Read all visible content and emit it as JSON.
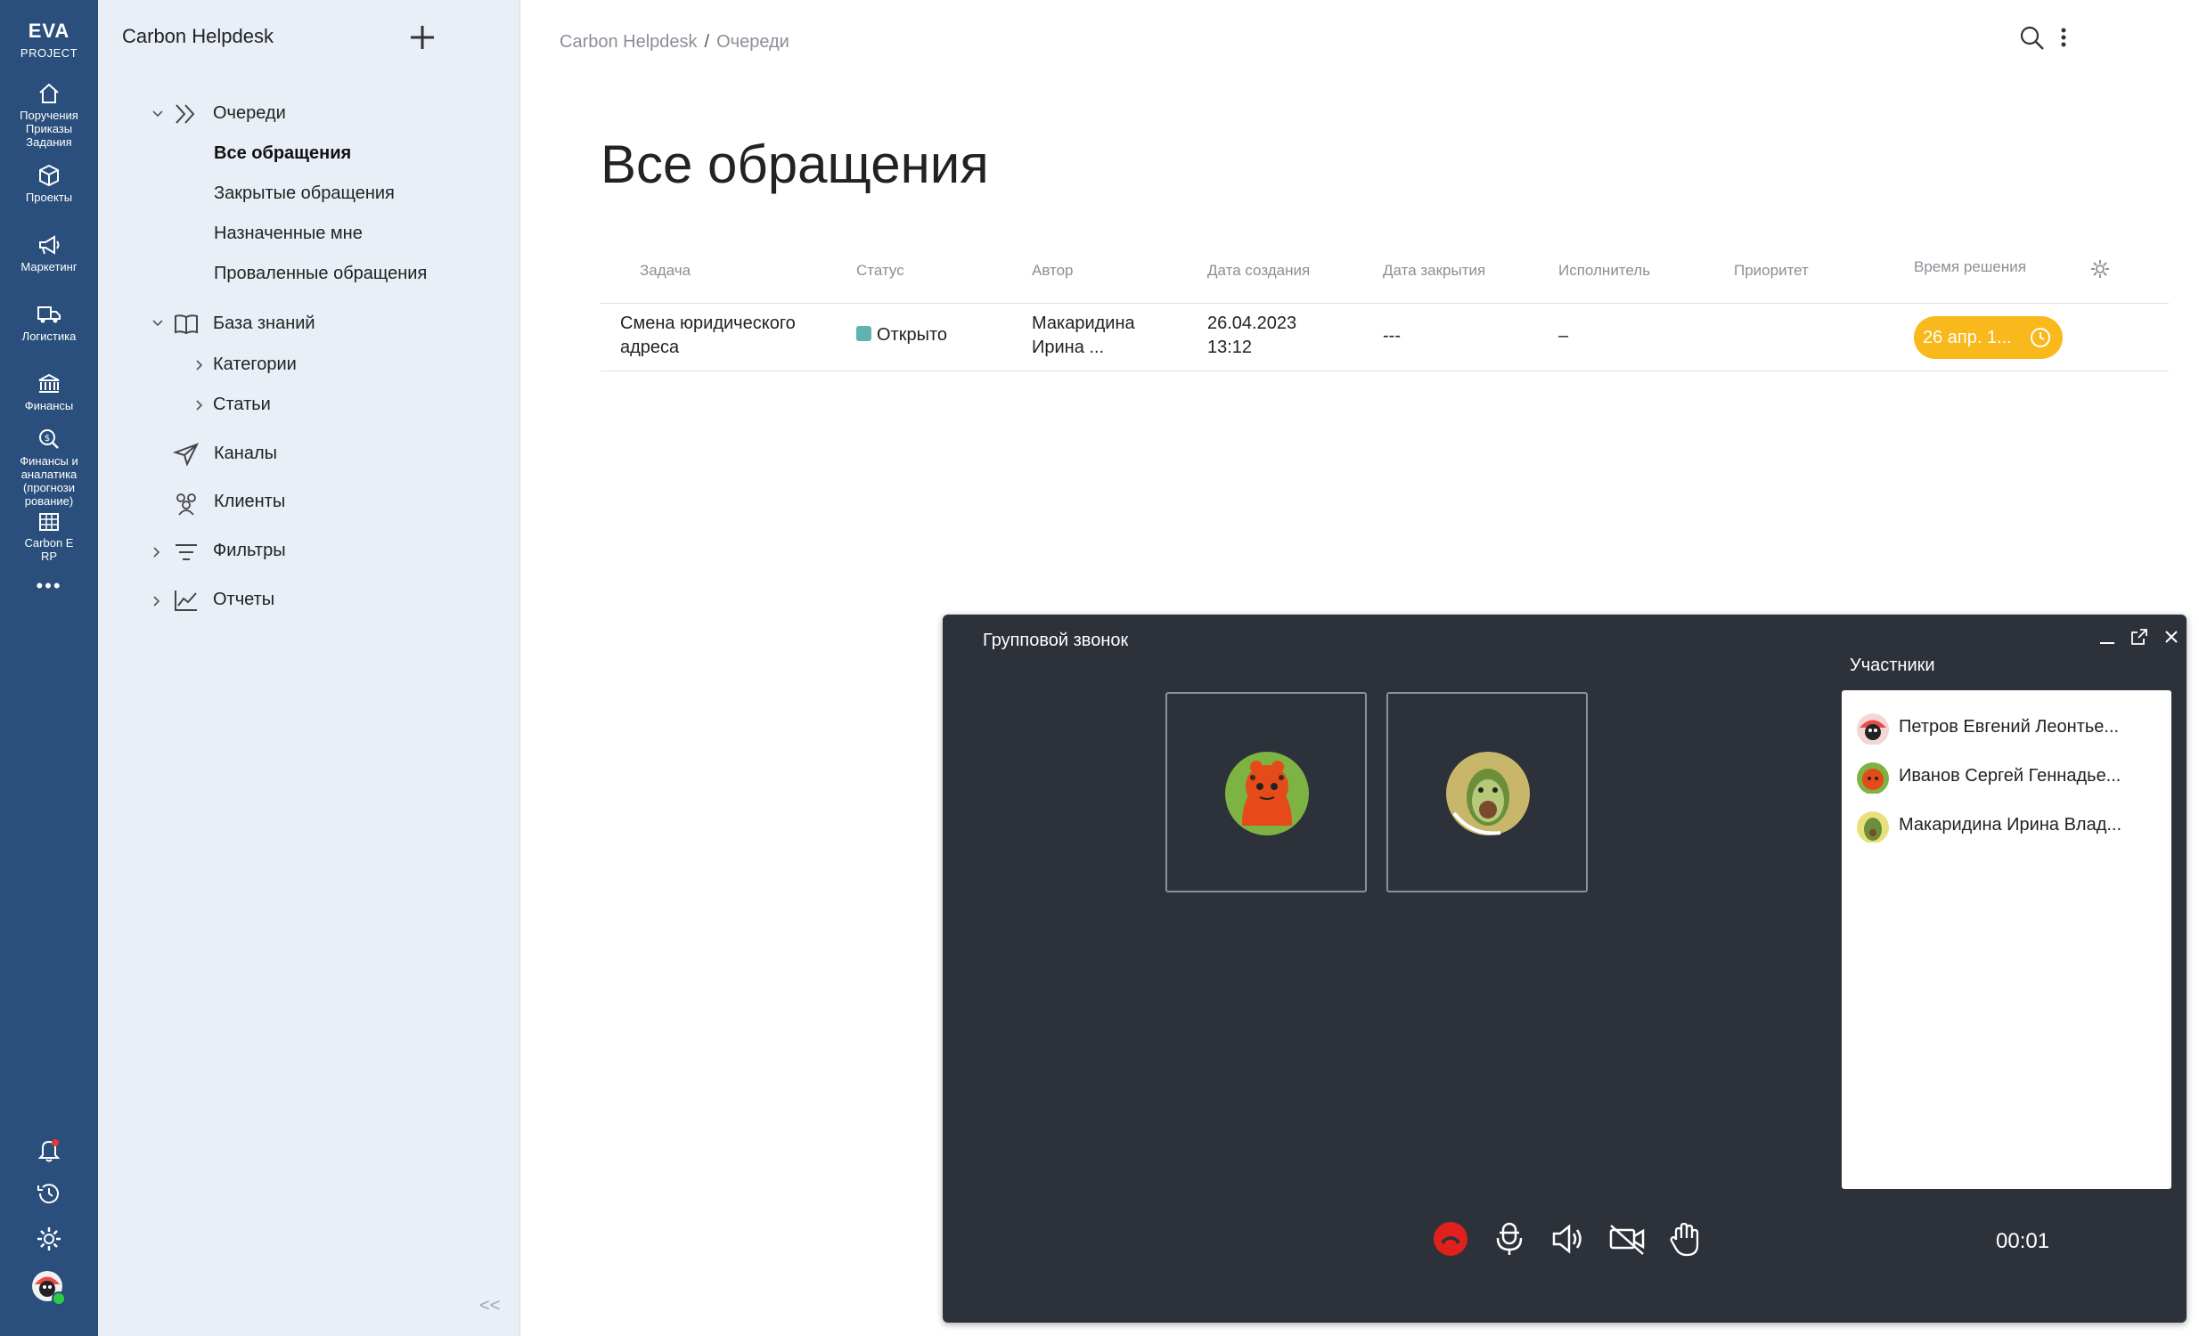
{
  "rail": {
    "logo_line1": "EVA",
    "logo_line2": "PROJECT",
    "items": [
      {
        "label": "Поручения Приказы Задания",
        "icon": "home-icon"
      },
      {
        "label": "Проекты",
        "icon": "cube-icon"
      },
      {
        "label": "Маркетинг",
        "icon": "megaphone-icon"
      },
      {
        "label": "Логистика",
        "icon": "truck-icon"
      },
      {
        "label": "Финансы",
        "icon": "bank-icon"
      },
      {
        "label": "Финансы и аналатика (прогнози рование)",
        "icon": "search-coin-icon"
      },
      {
        "label": "Carbon E RP",
        "icon": "grid-building-icon"
      }
    ],
    "more": "•••"
  },
  "nav": {
    "app_title": "Carbon Helpdesk",
    "queues": "Очереди",
    "all_requests": "Все обращения",
    "closed_requests": "Закрытые обращения",
    "assigned_to_me": "Назначенные мне",
    "failed_requests": "Проваленные обращения",
    "knowledge_base": "База знаний",
    "categories": "Категории",
    "articles": "Статьи",
    "channels": "Каналы",
    "clients": "Клиенты",
    "filters": "Фильтры",
    "reports": "Отчеты",
    "collapse": "<<"
  },
  "breadcrumb": {
    "root": "Carbon Helpdesk",
    "sep": "/",
    "current": "Очереди"
  },
  "page_title": "Все обращения",
  "table": {
    "headers": [
      "Задача",
      "Статус",
      "Автор",
      "Дата создания",
      "Дата закрытия",
      "Исполнитель",
      "Приоритет",
      "Время решения"
    ],
    "rows": [
      {
        "task_line1": "Смена юридического",
        "task_line2": "адреса",
        "status": "Открыто",
        "author_line1": "Макаридина",
        "author_line2": "Ирина ...",
        "created_line1": "26.04.2023",
        "created_line2": "13:12",
        "closed": "---",
        "assignee": "–",
        "priority": "",
        "resolution": "26 апр. 1..."
      }
    ]
  },
  "call": {
    "title": "Групповой звонок",
    "participants_title": "Участники",
    "participants": [
      {
        "name": "Петров Евгений Леонтье..."
      },
      {
        "name": "Иванов Сергей Геннадье..."
      },
      {
        "name": "Макаридина Ирина Влад..."
      }
    ],
    "timer": "00:01",
    "colors": {
      "hangup": "#e0201b",
      "badge": "#f9b81b",
      "window": "#2d323a"
    }
  }
}
